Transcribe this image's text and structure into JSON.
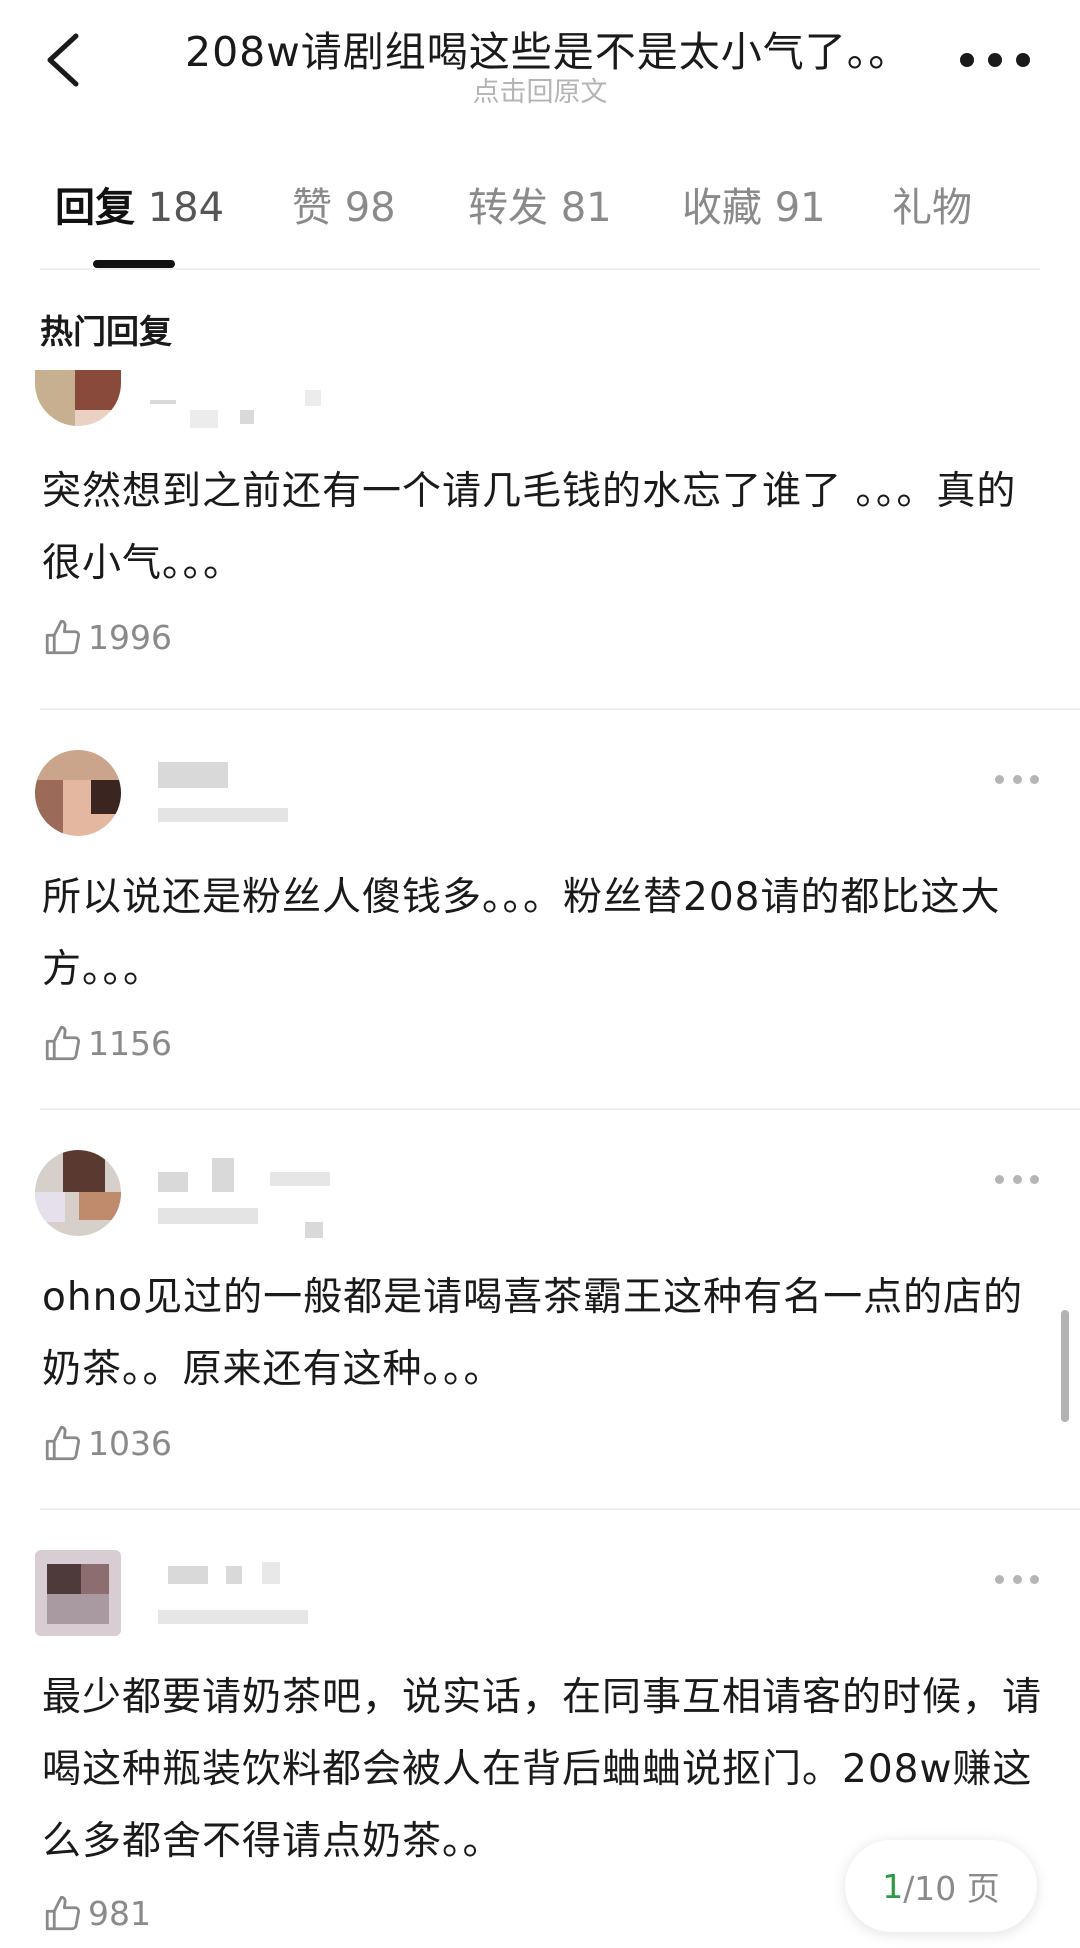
{
  "header": {
    "title": "208w请剧组喝这些是不是太小气了。。",
    "subtitle": "点击回原文"
  },
  "tabs": [
    {
      "label": "回复",
      "count": "184"
    },
    {
      "label": "赞",
      "count": "98"
    },
    {
      "label": "转发",
      "count": "81"
    },
    {
      "label": "收藏",
      "count": "91"
    },
    {
      "label": "礼物",
      "count": ""
    }
  ],
  "active_tab": "回复",
  "section_title": "热门回复",
  "comments": [
    {
      "text": "突然想到之前还有一个请几毛钱的水忘了谁了 。。。真的很小气。。。",
      "likes": "1996"
    },
    {
      "text": "所以说还是粉丝人傻钱多。。。粉丝替208请的都比这大方。。。",
      "likes": "1156"
    },
    {
      "text": "ohno见过的一般都是请喝喜茶霸王这种有名一点的店的奶茶。。原来还有这种。。。",
      "likes": "1036"
    },
    {
      "text": "最少都要请奶茶吧，说实话，在同事互相请客的时候，请喝这种瓶装饮料都会被人在背后蛐蛐说抠门。208w赚这么多都舍不得请点奶茶。。",
      "likes": "981"
    }
  ],
  "pager": {
    "current": "1",
    "total_label": "/10 页"
  },
  "colors": {
    "accent_green": "#2e9b45",
    "muted_text": "#8a8a8a",
    "divider": "#efefef"
  }
}
